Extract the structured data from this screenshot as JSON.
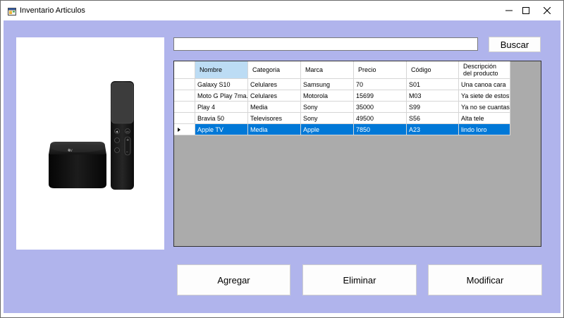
{
  "window": {
    "title": "Inventario Articulos"
  },
  "search": {
    "value": "",
    "placeholder": "",
    "button_label": "Buscar"
  },
  "grid": {
    "columns": [
      "Nombre",
      "Categoria",
      "Marca",
      "Precio",
      "Código",
      "Descripción\ndel producto"
    ],
    "rows": [
      [
        "Galaxy S10",
        "Celulares",
        "Samsung",
        "70",
        "S01",
        "Una canoa cara"
      ],
      [
        "Moto G Play 7ma...",
        "Celulares",
        "Motorola",
        "15699",
        "M03",
        "Ya siete de estos?"
      ],
      [
        "Play 4",
        "Media",
        "Sony",
        "35000",
        "S99",
        "Ya no se cuantas..."
      ],
      [
        "Bravia 50",
        "Televisores",
        "Sony",
        "49500",
        "S56",
        "Alta tele"
      ],
      [
        "Apple TV",
        "Media",
        "Apple",
        "7850",
        "A23",
        "lindo loro"
      ]
    ],
    "selected_row_index": 4,
    "sorted_column_index": 0
  },
  "product_image": {
    "subject": "Apple TV box with Siri remote"
  },
  "actions": {
    "add_label": "Agregar",
    "delete_label": "Eliminar",
    "modify_label": "Modificar"
  },
  "colors": {
    "form_background": "#b0b4ec",
    "selection": "#0078d7",
    "grid_background": "#ababab"
  }
}
